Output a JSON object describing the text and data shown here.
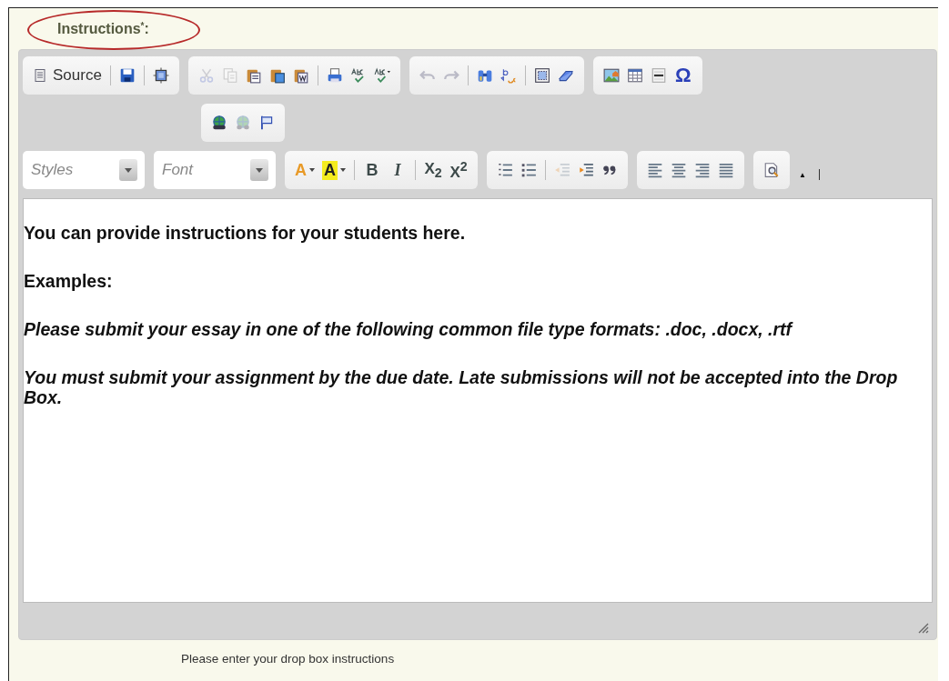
{
  "field_label": {
    "text": "Instructions",
    "required_mark": "*",
    "colon": ":"
  },
  "toolbar_rows": [
    [
      {
        "items": [
          {
            "kind": "source",
            "label": "Source",
            "disabled": false
          },
          {
            "kind": "separator"
          },
          {
            "kind": "save",
            "disabled": false
          },
          {
            "kind": "separator"
          },
          {
            "kind": "template",
            "disabled": false
          }
        ]
      },
      {
        "items": [
          {
            "kind": "cut",
            "disabled": true
          },
          {
            "kind": "copy",
            "disabled": true
          },
          {
            "kind": "paste",
            "disabled": false
          },
          {
            "kind": "paste-text",
            "disabled": false
          },
          {
            "kind": "paste-word",
            "disabled": false
          },
          {
            "kind": "separator"
          },
          {
            "kind": "print",
            "disabled": false
          },
          {
            "kind": "spellcheck",
            "disabled": false
          },
          {
            "kind": "spellcheck-menu",
            "disabled": false
          }
        ]
      },
      {
        "items": [
          {
            "kind": "undo",
            "disabled": true
          },
          {
            "kind": "redo",
            "disabled": true
          },
          {
            "kind": "separator"
          },
          {
            "kind": "find",
            "disabled": false
          },
          {
            "kind": "replace",
            "disabled": false
          },
          {
            "kind": "separator"
          },
          {
            "kind": "select-all",
            "disabled": false
          },
          {
            "kind": "eraser",
            "disabled": false
          }
        ]
      },
      {
        "items": [
          {
            "kind": "image",
            "disabled": false
          },
          {
            "kind": "table",
            "disabled": false
          },
          {
            "kind": "rule",
            "disabled": false
          },
          {
            "kind": "symbol",
            "text": "Ω",
            "disabled": false
          }
        ]
      }
    ],
    [
      {
        "items": [
          {
            "kind": "link",
            "disabled": false
          },
          {
            "kind": "unlink",
            "disabled": true
          },
          {
            "kind": "anchor",
            "disabled": false
          }
        ]
      }
    ],
    [
      {
        "kind": "combo",
        "placeholder": "Styles"
      },
      {
        "kind": "combo",
        "placeholder": "Font"
      },
      {
        "items": [
          {
            "kind": "text-color",
            "text": "A",
            "disabled": false
          },
          {
            "kind": "bg-color",
            "text": "A",
            "disabled": false
          },
          {
            "kind": "separator"
          },
          {
            "kind": "bold",
            "text": "B",
            "disabled": false
          },
          {
            "kind": "italic",
            "text": "I",
            "disabled": false
          },
          {
            "kind": "separator"
          },
          {
            "kind": "script",
            "text": "X$_{2}$",
            "disabled": false
          },
          {
            "kind": "script",
            "text": "X$^{2}$",
            "disabled": false
          }
        ]
      },
      {
        "items": [
          {
            "kind": "numbered-list",
            "disabled": false
          },
          {
            "kind": "bullet-list",
            "disabled": false
          },
          {
            "kind": "separator"
          },
          {
            "kind": "outdent",
            "disabled": true
          },
          {
            "kind": "indent",
            "disabled": false
          },
          {
            "kind": "quote",
            "disabled": false
          }
        ]
      },
      {
        "items": [
          {
            "kind": "align-left",
            "disabled": false
          },
          {
            "kind": "align-center",
            "disabled": false
          },
          {
            "kind": "align-right",
            "disabled": false
          },
          {
            "kind": "justify",
            "disabled": false
          }
        ]
      },
      {
        "items": [
          {
            "kind": "preview",
            "disabled": false
          }
        ]
      }
    ]
  ],
  "collapse_toggle": "▲",
  "content": [
    {
      "kind": "bold",
      "text": "You can provide instructions for your students here."
    },
    {
      "kind": "bold",
      "text": "Examples:"
    },
    {
      "kind": "bold-italic",
      "text": "Please submit your essay in one of the following common file type formats: .doc, .docx, .rtf"
    },
    {
      "kind": "bold-italic",
      "text": "You must submit your assignment by the due date. Late submissions will not be accepted into the Drop Box."
    }
  ],
  "hint": "Please enter your drop box instructions"
}
